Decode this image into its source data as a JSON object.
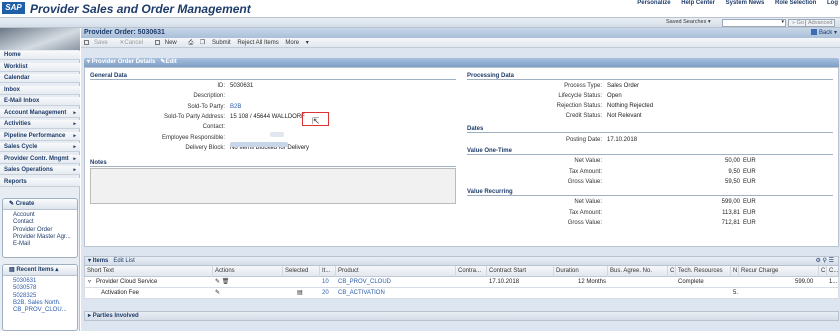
{
  "header": {
    "logo": "SAP",
    "title": "Provider Sales and Order Management",
    "links": [
      "Personalize",
      "Help Center",
      "System News",
      "Role Selection",
      "Log"
    ]
  },
  "searchbar": {
    "saved_searches": "Saved Searches",
    "go": "Go",
    "advanced": "Advanced"
  },
  "nav": {
    "items": [
      {
        "label": "Home",
        "arrow": ""
      },
      {
        "label": "Worklist",
        "arrow": ""
      },
      {
        "label": "Calendar",
        "arrow": ""
      },
      {
        "label": "Inbox",
        "arrow": ""
      },
      {
        "label": "E-Mail Inbox",
        "arrow": ""
      },
      {
        "label": "Account Management",
        "arrow": "▸"
      },
      {
        "label": "Activities",
        "arrow": "▸"
      },
      {
        "label": "Pipeline Performance",
        "arrow": "▸"
      },
      {
        "label": "Sales Cycle",
        "arrow": "▸"
      },
      {
        "label": "Provider Contr. Mngmt",
        "arrow": "▸"
      },
      {
        "label": "Sales Operations",
        "arrow": "▸"
      },
      {
        "label": "Reports",
        "arrow": ""
      }
    ],
    "create": {
      "title": "Create",
      "items": [
        "Account",
        "Contact",
        "Provider Order",
        "Provider Master Agr...",
        "E-Mail"
      ]
    },
    "recent": {
      "title": "Recent Items",
      "items": [
        "5030631",
        "5030578",
        "5028325",
        "B2B. Sales North.",
        "CB_PROV_CLOU..."
      ]
    }
  },
  "page": {
    "title": "Provider Order: 5030631",
    "back": "Back",
    "toolbar": [
      "Save",
      "Cancel",
      "New",
      "Submit",
      "Reject All Items",
      "More"
    ]
  },
  "details": {
    "header": "Provider Order Details",
    "edit": "Edit",
    "general": {
      "title": "General Data",
      "fields": [
        {
          "label": "ID:",
          "value": "5030631"
        },
        {
          "label": "Description:",
          "value": ""
        },
        {
          "label": "Sold-To Party:",
          "value": "B2B"
        },
        {
          "label": "Sold-To Party Address:",
          "value": "15 108 / 45644 WALLDORF"
        },
        {
          "label": "Contact:",
          "value": ""
        },
        {
          "label": "Employee Responsible:",
          "value": ""
        },
        {
          "label": "Delivery Block:",
          "value": "No Items Blocked for Delivery"
        }
      ]
    },
    "notes_title": "Notes",
    "processing": {
      "title": "Processing Data",
      "fields": [
        {
          "label": "Process Type:",
          "value": "Sales Order"
        },
        {
          "label": "Lifecycle Status:",
          "value": "Open"
        },
        {
          "label": "Rejection Status:",
          "value": "Nothing Rejected"
        },
        {
          "label": "Credit Status:",
          "value": "Not Relevant"
        }
      ]
    },
    "dates": {
      "title": "Dates",
      "fields": [
        {
          "label": "Posting Date:",
          "value": "17.10.2018"
        }
      ]
    },
    "one_time": {
      "title": "Value One-Time",
      "fields": [
        {
          "label": "Net Value:",
          "value": "50,00",
          "cur": "EUR"
        },
        {
          "label": "Tax Amount:",
          "value": "9,50",
          "cur": "EUR"
        },
        {
          "label": "Gross Value:",
          "value": "59,50",
          "cur": "EUR"
        }
      ]
    },
    "recurring": {
      "title": "Value Recurring",
      "fields": [
        {
          "label": "Net Value:",
          "value": "599,00",
          "cur": "EUR"
        },
        {
          "label": "Tax Amount:",
          "value": "113,81",
          "cur": "EUR"
        },
        {
          "label": "Gross Value:",
          "value": "712,81",
          "cur": "EUR"
        }
      ]
    }
  },
  "items": {
    "tab": "Items",
    "edit_list": "Edit List",
    "columns": [
      "Short Text",
      "Actions",
      "Selected",
      "It...",
      "Product",
      "Contra...",
      "Contract Start",
      "Duration",
      "Bus. Agree. No.",
      "C",
      "Tech. Resources",
      "N",
      "Recur Charge",
      "C",
      "C..."
    ],
    "rows": [
      {
        "text": "Provider Cloud Service",
        "item": "10",
        "product": "CB_PROV_CLOUD",
        "start": "17.10.2018",
        "duration": "12 Months",
        "tech": "Complete",
        "charge": "599,00",
        "c2": "1..."
      },
      {
        "text": "Activation Fee",
        "item": "20",
        "product": "CB_ACTIVATION",
        "start": "",
        "duration": "",
        "tech": "",
        "charge": "",
        "n": "5."
      }
    ]
  },
  "parties": "Parties Involved"
}
